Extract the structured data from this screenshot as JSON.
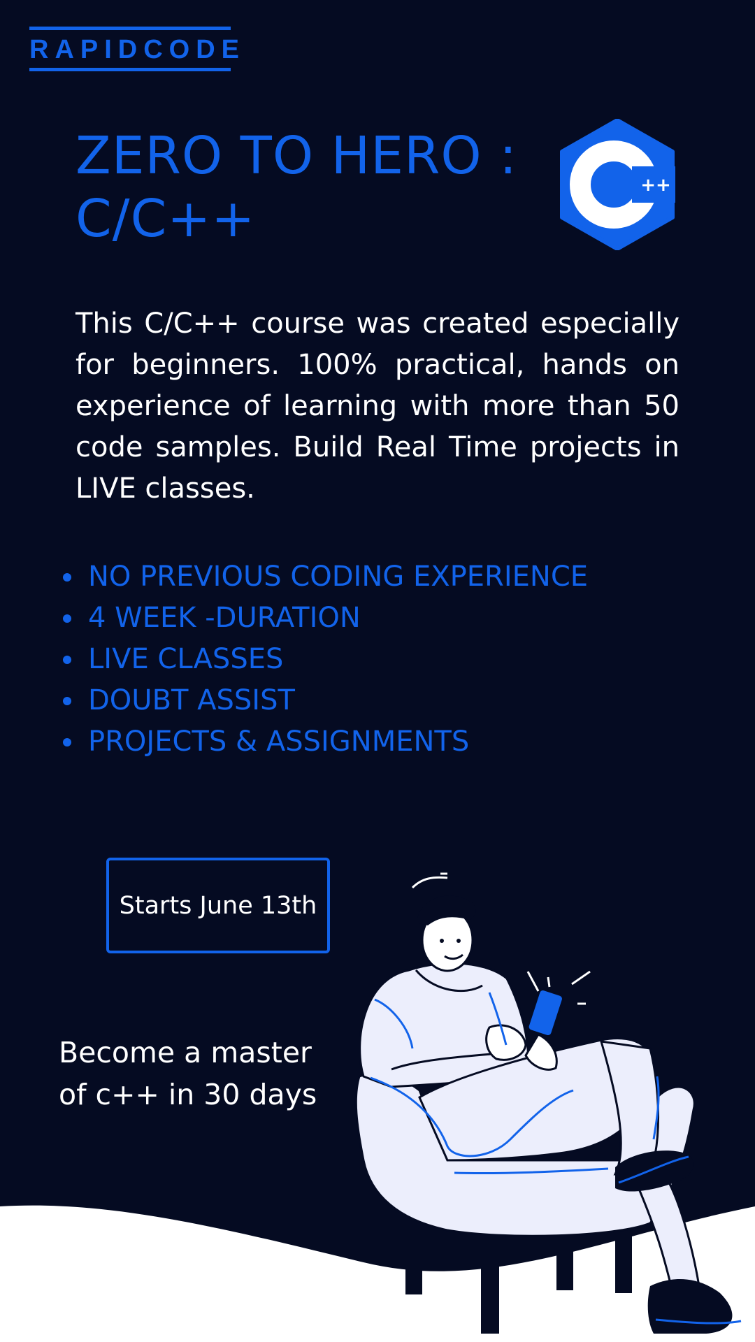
{
  "brand": "RAPIDCODE",
  "title": {
    "line1": "ZERO TO HERO :",
    "line2": "C/C++"
  },
  "logo": {
    "icon": "cpp-hexagon-icon",
    "letter": "C",
    "plus": "++"
  },
  "description": "This C/C++ course was created especially for beginners. 100% practical, hands on experience of learning with more than 50 code samples. Build Real Time projects in LIVE classes.",
  "features": [
    "NO PREVIOUS CODING EXPERIENCE",
    "4 WEEK -DURATION",
    "LIVE CLASSES",
    "DOUBT ASSIST",
    "PROJECTS & ASSIGNMENTS"
  ],
  "start_label": "Starts June 13th",
  "tagline": {
    "line1": "Become a master",
    "line2": "of c++ in 30 days"
  },
  "illustration": "person-in-armchair-with-phone",
  "colors": {
    "background": "#050b22",
    "accent": "#1263ea",
    "text": "#ffffff",
    "figure_fill": "#eceefc"
  }
}
